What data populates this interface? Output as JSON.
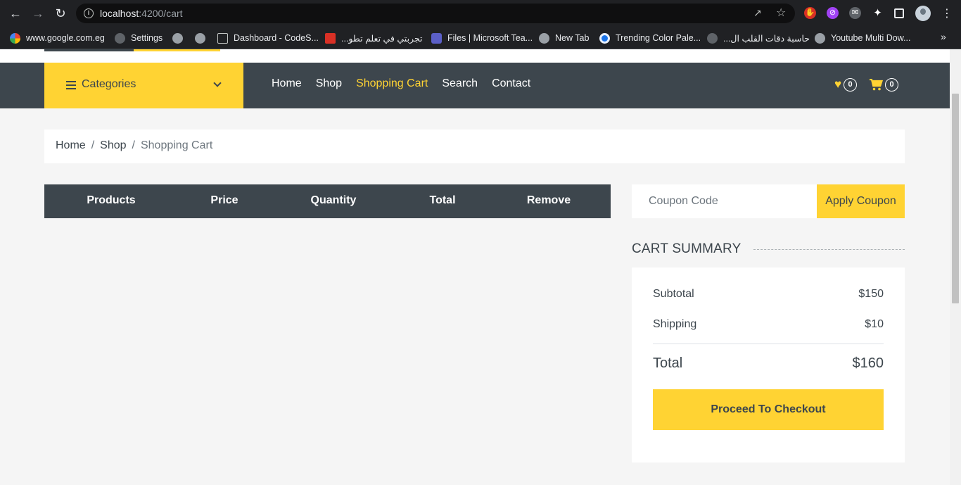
{
  "browser": {
    "url_host": "localhost",
    "url_path": ":4200/cart",
    "bookmarks": [
      {
        "label": "www.google.com.eg",
        "icon": "google-icon"
      },
      {
        "label": "Settings",
        "icon": "gear-icon"
      },
      {
        "label": "",
        "icon": "globe-icon"
      },
      {
        "label": "",
        "icon": "globe-icon"
      },
      {
        "label": "Dashboard - CodeS...",
        "icon": "page-icon"
      },
      {
        "label": "تجربتي في تعلم تطو...",
        "icon": "bookmark-red-icon"
      },
      {
        "label": "Files | Microsoft Tea...",
        "icon": "teams-icon"
      },
      {
        "label": "New Tab",
        "icon": "globe-icon"
      },
      {
        "label": "Trending Color Pale...",
        "icon": "palette-icon"
      },
      {
        "label": "حاسبة دقات القلب ال...",
        "icon": "heart-icon"
      },
      {
        "label": "Youtube Multi Dow...",
        "icon": "globe-icon"
      }
    ]
  },
  "navbar": {
    "categories_label": "Categories",
    "links": [
      {
        "label": "Home",
        "active": false
      },
      {
        "label": "Shop",
        "active": false
      },
      {
        "label": "Shopping Cart",
        "active": true
      },
      {
        "label": "Search",
        "active": false
      },
      {
        "label": "Contact",
        "active": false
      }
    ],
    "wishlist_count": "0",
    "cart_count": "0"
  },
  "breadcrumb": {
    "items": [
      "Home",
      "Shop"
    ],
    "current": "Shopping Cart",
    "separator": "/"
  },
  "cart_table": {
    "headers": [
      "Products",
      "Price",
      "Quantity",
      "Total",
      "Remove"
    ]
  },
  "coupon": {
    "placeholder": "Coupon Code",
    "button_label": "Apply Coupon"
  },
  "summary": {
    "title": "CART SUMMARY",
    "subtotal_label": "Subtotal",
    "subtotal_value": "$150",
    "shipping_label": "Shipping",
    "shipping_value": "$10",
    "total_label": "Total",
    "total_value": "$160",
    "checkout_label": "Proceed To Checkout"
  },
  "colors": {
    "accent": "#ffd333",
    "dark": "#3d464d",
    "background": "#f5f5f5"
  }
}
